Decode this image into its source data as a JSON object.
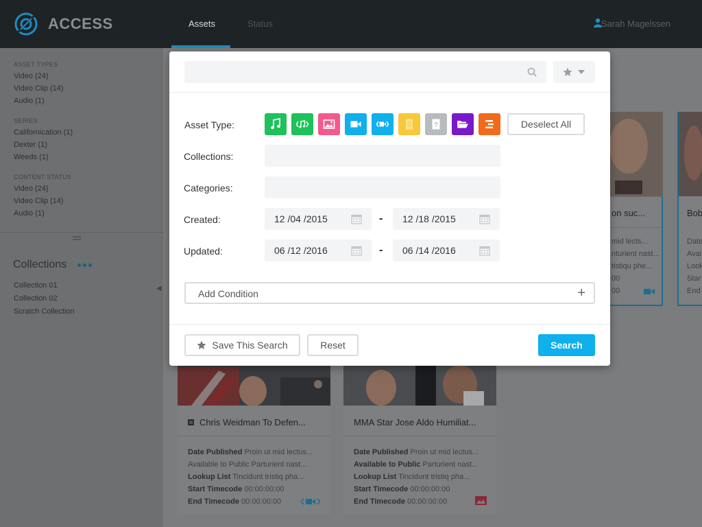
{
  "app": {
    "name": "ACCESS",
    "accent": "#1f8bc0"
  },
  "nav": {
    "tabs": [
      {
        "label": "Assets",
        "active": true
      },
      {
        "label": "Status",
        "active": false
      }
    ],
    "user": "Sarah Magelssen"
  },
  "sidebar": {
    "asset_types": {
      "heading": "ASSET TYPES",
      "items": [
        "Video (24)",
        "Video Clip (14)",
        "Audio (1)"
      ]
    },
    "series": {
      "heading": "SERIES",
      "items": [
        "Californication (1)",
        "Dexter (1)",
        "Weeds (1)"
      ]
    },
    "content_status": {
      "heading": "CONTENT STATUS",
      "items": [
        "Video (24)",
        "Video Clip (14)",
        "Audio (1)"
      ]
    },
    "collections": {
      "title": "Collections",
      "items": [
        "Collection 01",
        "Collection 02",
        "Scratch Collection"
      ]
    }
  },
  "cards": [
    {
      "title": "Chris Weidman To Defen...",
      "meta": [
        {
          "label": "Date Published",
          "value": "Proin ut mid lectus..."
        },
        {
          "label": "Available to Public",
          "value": "Parturient nast..."
        },
        {
          "label": "Lookup List",
          "value": "Tincidunt tristiq pha..."
        },
        {
          "label": "Start Timecode",
          "value": "00:00:00:00"
        },
        {
          "label": "End Timecode",
          "value": "00:00:00:00"
        }
      ]
    },
    {
      "title": "MMA Star Jose Aldo Humiliat...",
      "meta": [
        {
          "label": "Date Published",
          "value": "Proin ut mid lectus..."
        },
        {
          "label": "Available to Public",
          "value": "Parturient nast..."
        },
        {
          "label": "Lookup List",
          "value": "Tincidunt tristiq pha..."
        },
        {
          "label": "Start Timecode",
          "value": "00:00:00:00"
        },
        {
          "label": "End Timecode",
          "value": "00:00:00:00"
        }
      ]
    }
  ],
  "right_cards": {
    "card1": {
      "title": "on suc...",
      "lines": [
        "mid lects...",
        "nturient nast...",
        "tistiqu phe...",
        "00",
        "00"
      ]
    },
    "card2": {
      "title": "Bob",
      "lines": [
        "Date",
        "Avai",
        "Look",
        "Star",
        "End"
      ]
    }
  },
  "modal": {
    "search": {
      "placeholder": ""
    },
    "labels": {
      "asset_type": "Asset Type:",
      "collections": "Collections:",
      "categories": "Categories:",
      "created": "Created:",
      "updated": "Updated:"
    },
    "asset_type_icons": [
      {
        "icon": "music-icon",
        "color": "#1ec15a"
      },
      {
        "icon": "audio-clip-icon",
        "color": "#1ec15a"
      },
      {
        "icon": "image-icon",
        "color": "#f25a8e"
      },
      {
        "icon": "video-icon",
        "color": "#0fb0ec"
      },
      {
        "icon": "video-clip-icon",
        "color": "#0fb0ec"
      },
      {
        "icon": "document-icon",
        "color": "#f7c83a"
      },
      {
        "icon": "unknown-icon",
        "color": "#b8bbbd"
      },
      {
        "icon": "folder-icon",
        "color": "#7a19c9"
      },
      {
        "icon": "timeline-icon",
        "color": "#f26a1b"
      }
    ],
    "deselect_all": "Deselect All",
    "created": {
      "from": "12 /04 /2015",
      "to": "12 /18 /2015"
    },
    "updated": {
      "from": "06 /12 /2016",
      "to": "06 /14 /2016"
    },
    "dash": "-",
    "add_condition": "Add Condition",
    "add_condition_plus": "+",
    "save_search": "Save This Search",
    "reset": "Reset",
    "search_button": "Search",
    "search_color": "#0fb0ec"
  }
}
